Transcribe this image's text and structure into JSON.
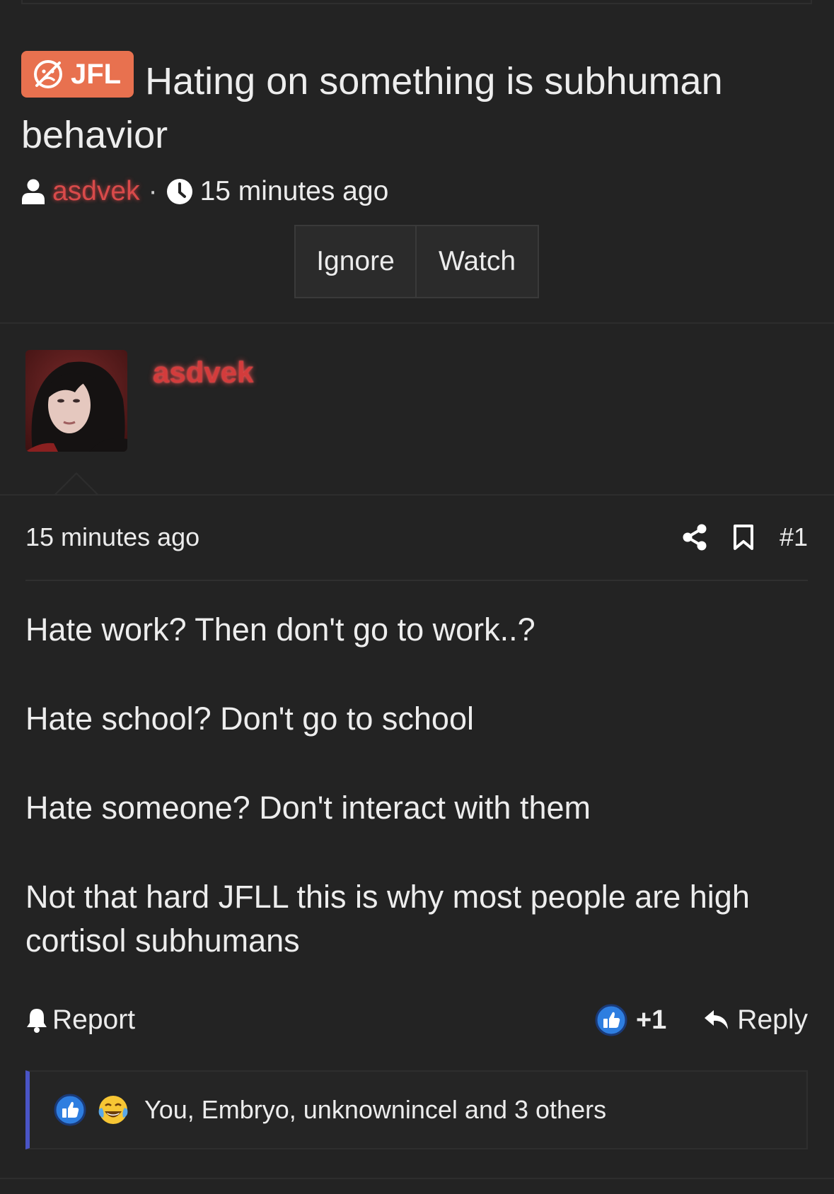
{
  "thread": {
    "prefix": "JFL",
    "title": "Hating on something is subhuman behavior",
    "author": "asdvek",
    "time": "15 minutes ago",
    "buttons": {
      "ignore": "Ignore",
      "watch": "Watch"
    }
  },
  "post": {
    "username": "asdvek",
    "time": "15 minutes ago",
    "number": "#1",
    "body": [
      "Hate work? Then don't go to work..?",
      "Hate school? Don't go to school",
      "Hate someone? Don't interact with them",
      "Not that hard JFLL this is why most people are high cortisol subhumans"
    ],
    "report_label": "Report",
    "reaction_count": "+1",
    "reply_label": "Reply",
    "reactions_text": "You, Embryo, unknownincel and 3 others"
  },
  "colors": {
    "background": "#232323",
    "prefix": "#e8714f",
    "username": "#d33c3c",
    "reaction_bar_accent": "#4a54c6",
    "like_blue": "#2e7ee0"
  },
  "icons": [
    "user-icon",
    "clock-icon",
    "share-icon",
    "bookmark-icon",
    "bell-icon",
    "like-icon",
    "reply-icon",
    "laugh-cry-icon"
  ]
}
